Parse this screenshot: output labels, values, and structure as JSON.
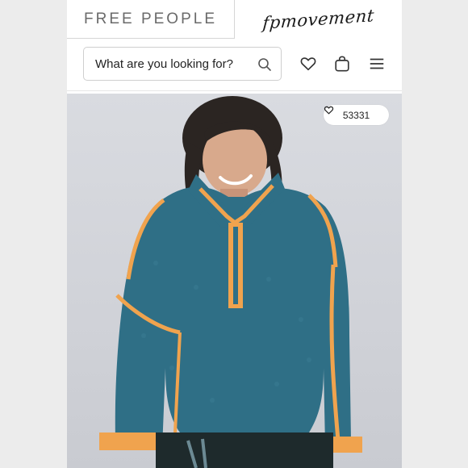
{
  "header": {
    "brand_tab": "FREE PEOPLE",
    "movement_tab": "fpmovement"
  },
  "search": {
    "placeholder": "What are you looking for?"
  },
  "icons": {
    "search": "search-icon",
    "wishlist": "heart-icon",
    "bag": "shopping-bag-icon",
    "menu": "hamburger-menu-icon"
  },
  "product": {
    "like_count": "53331",
    "colors": {
      "fleece": "#2f6f86",
      "trim": "#f0a34e"
    }
  }
}
